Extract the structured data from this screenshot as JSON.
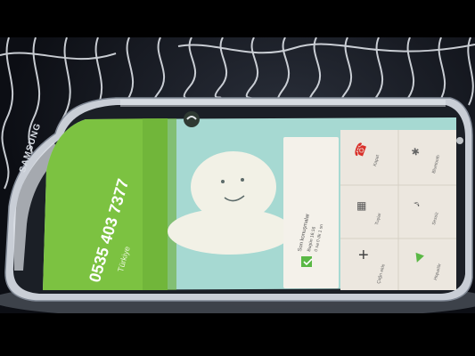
{
  "phone": {
    "brand": "SAMSUNG",
    "number": "0535 403 7377",
    "country": "Türkiye"
  },
  "call_log": {
    "title": "Son konuşmalar",
    "entry_time": "Bugün 16:16",
    "entry_duration": "0 sa 0 dk 1 sn"
  },
  "actions": {
    "end_call": "Kapat",
    "bluetooth": "Bluetooth",
    "keypad": "Tuşlar",
    "mute": "Sessiz",
    "add_call": "Çağrı ekle",
    "speaker": "Hoparlör"
  },
  "colors": {
    "green": "#7cc241",
    "teal_background": "#a6d9d2",
    "end_call_red": "#d9302a",
    "panel": "#ece7df"
  }
}
